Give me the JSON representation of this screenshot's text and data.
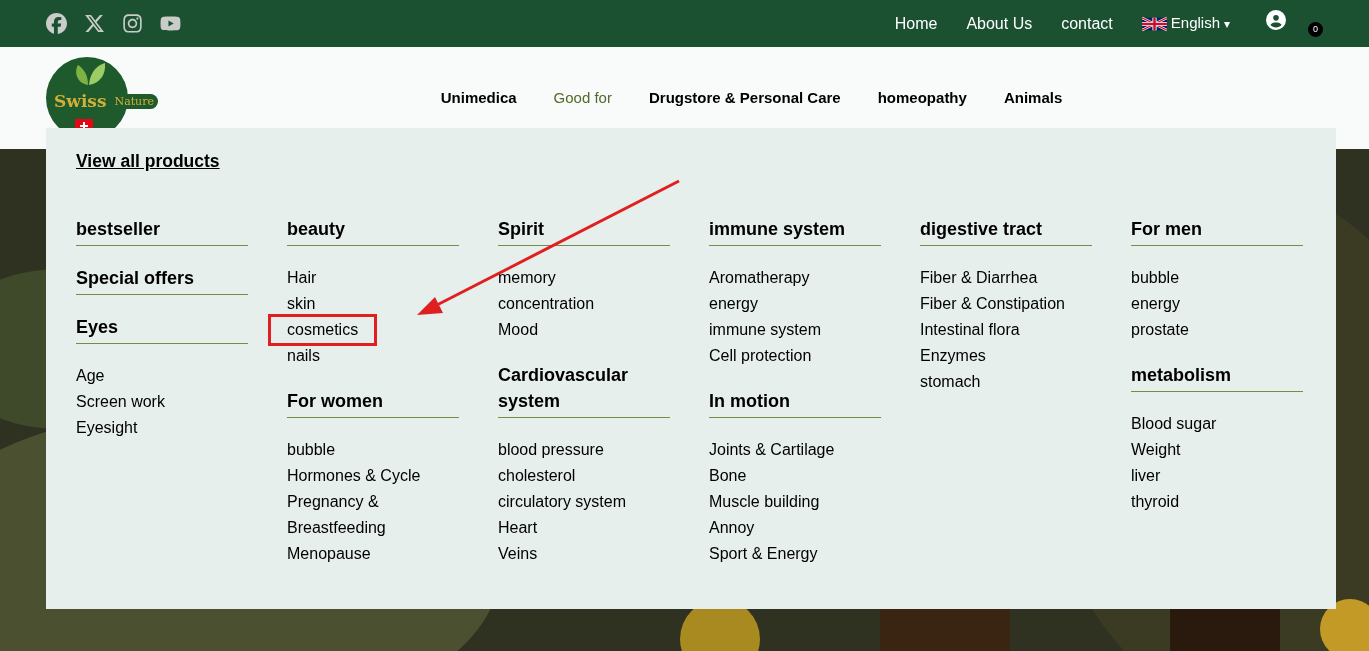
{
  "top_bar": {
    "social": [
      {
        "kind": "facebook"
      },
      {
        "kind": "x"
      },
      {
        "kind": "instagram"
      },
      {
        "kind": "youtube"
      }
    ],
    "links": [
      "Home",
      "About Us",
      "contact"
    ],
    "language": {
      "label": "English",
      "caret": "▾"
    },
    "cart_count": "0"
  },
  "logo": {
    "word": "Swiss",
    "tagline": "Nature"
  },
  "nav": [
    {
      "label": "Unimedica",
      "selected": false
    },
    {
      "label": "Good for",
      "selected": true
    },
    {
      "label": "Drugstore & Personal Care",
      "selected": false
    },
    {
      "label": "homeopathy",
      "selected": false
    },
    {
      "label": "Animals",
      "selected": false
    }
  ],
  "mega_menu": {
    "view_all": "View all products",
    "columns": [
      [
        {
          "heading": "bestseller"
        },
        {
          "heading": "Special offers"
        },
        {
          "heading": "Eyes",
          "items": [
            {
              "label": "Age",
              "outlined": false
            },
            {
              "label": "Screen work",
              "outlined": false
            },
            {
              "label": "Eyesight",
              "outlined": false
            }
          ]
        }
      ],
      [
        {
          "heading": "beauty",
          "items": [
            {
              "label": "Hair",
              "outlined": false
            },
            {
              "label": "skin",
              "outlined": false
            },
            {
              "label": "cosmetics",
              "outlined": true
            },
            {
              "label": "nails",
              "outlined": false
            }
          ]
        },
        {
          "heading": "For women",
          "items": [
            {
              "label": "bubble",
              "outlined": false
            },
            {
              "label": "Hormones & Cycle",
              "outlined": false
            },
            {
              "label": "Pregnancy & Breastfeeding",
              "outlined": false
            },
            {
              "label": "Menopause",
              "outlined": false
            }
          ]
        }
      ],
      [
        {
          "heading": "Spirit",
          "items": [
            {
              "label": "memory",
              "outlined": false
            },
            {
              "label": "concentration",
              "outlined": false
            },
            {
              "label": "Mood",
              "outlined": false
            }
          ]
        },
        {
          "heading": "Cardiovascular system",
          "items": [
            {
              "label": "blood pressure",
              "outlined": false
            },
            {
              "label": "cholesterol",
              "outlined": false
            },
            {
              "label": "circulatory system",
              "outlined": false
            },
            {
              "label": "Heart",
              "outlined": false
            },
            {
              "label": "Veins",
              "outlined": false
            }
          ]
        }
      ],
      [
        {
          "heading": "immune system",
          "items": [
            {
              "label": "Aromatherapy",
              "outlined": false
            },
            {
              "label": "energy",
              "outlined": false
            },
            {
              "label": "immune system",
              "outlined": false
            },
            {
              "label": "Cell protection",
              "outlined": false
            }
          ]
        },
        {
          "heading": "In motion",
          "items": [
            {
              "label": "Joints & Cartilage",
              "outlined": false
            },
            {
              "label": "Bone",
              "outlined": false
            },
            {
              "label": "Muscle building",
              "outlined": false
            },
            {
              "label": "Annoy",
              "outlined": false
            },
            {
              "label": "Sport & Energy",
              "outlined": false
            }
          ]
        }
      ],
      [
        {
          "heading": "digestive tract",
          "items": [
            {
              "label": "Fiber & Diarrhea",
              "outlined": false
            },
            {
              "label": "Fiber & Constipation",
              "outlined": false
            },
            {
              "label": "Intestinal flora",
              "outlined": false
            },
            {
              "label": "Enzymes",
              "outlined": false
            },
            {
              "label": "stomach",
              "outlined": false
            }
          ]
        }
      ],
      [
        {
          "heading": "For men",
          "items": [
            {
              "label": "bubble",
              "outlined": false
            },
            {
              "label": "energy",
              "outlined": false
            },
            {
              "label": "prostate",
              "outlined": false
            }
          ]
        },
        {
          "heading": "metabolism",
          "items": [
            {
              "label": "Blood sugar",
              "outlined": false
            },
            {
              "label": "Weight",
              "outlined": false
            },
            {
              "label": "liver",
              "outlined": false
            },
            {
              "label": "thyroid",
              "outlined": false
            }
          ]
        }
      ]
    ]
  }
}
